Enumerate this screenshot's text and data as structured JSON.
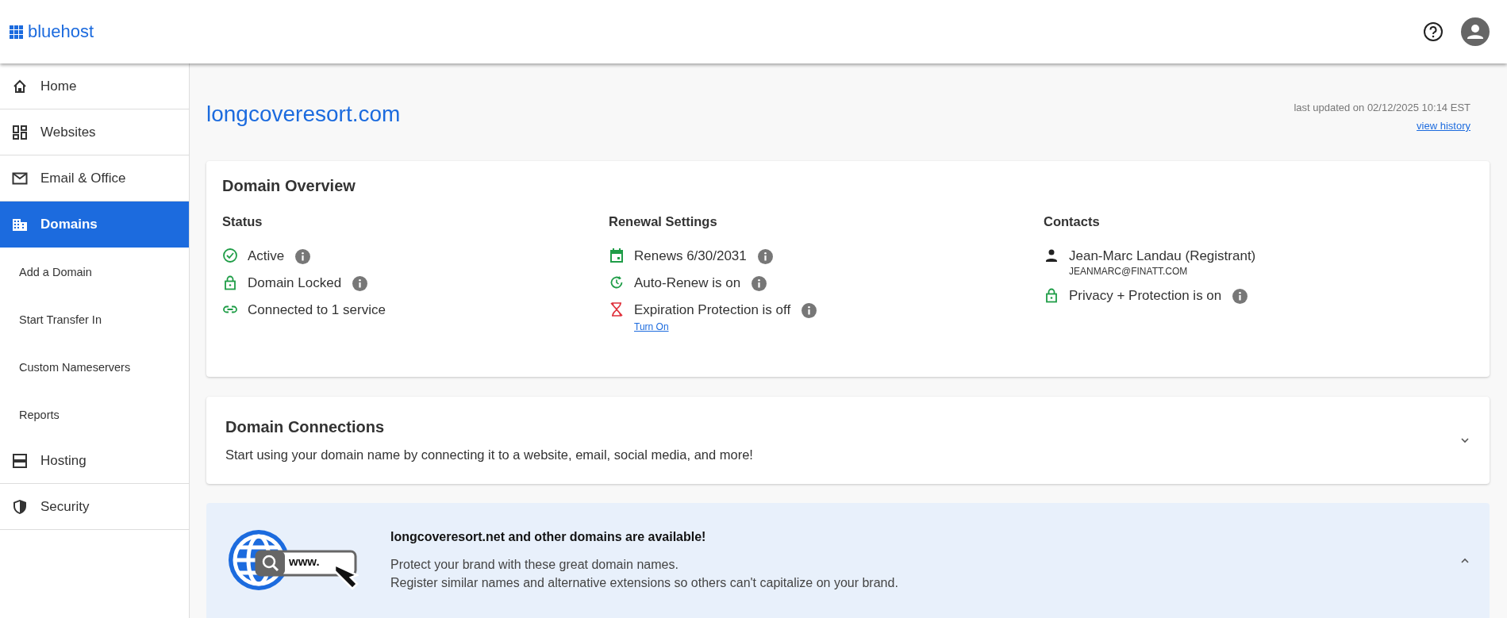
{
  "header": {
    "logo": "bluehost"
  },
  "sidebar": {
    "items": [
      {
        "label": "Home",
        "kind": "main",
        "selected": false
      },
      {
        "label": "Websites",
        "kind": "main",
        "selected": false
      },
      {
        "label": "Email & Office",
        "kind": "main",
        "selected": false
      },
      {
        "label": "Domains",
        "kind": "main",
        "selected": true
      },
      {
        "label": "Add a Domain",
        "kind": "sub",
        "selected": false
      },
      {
        "label": "Start Transfer In",
        "kind": "sub",
        "selected": false
      },
      {
        "label": "Custom Nameservers",
        "kind": "sub",
        "selected": false
      },
      {
        "label": "Reports",
        "kind": "sub",
        "selected": false
      },
      {
        "label": "Hosting",
        "kind": "main",
        "selected": false
      },
      {
        "label": "Security",
        "kind": "main",
        "selected": false
      }
    ]
  },
  "page": {
    "title": "longcoveresort.com",
    "last_updated": "last updated on 02/12/2025 10:14 EST",
    "history_link": "view history"
  },
  "domain_overview": {
    "title": "Domain Overview",
    "columns": [
      {
        "heading": "Status",
        "items": [
          {
            "label": "Active",
            "info": true
          },
          {
            "label": "Domain Locked",
            "info": true
          },
          {
            "label": "Connected to 1 service",
            "info": false
          }
        ]
      },
      {
        "heading": "Renewal Settings",
        "items": [
          {
            "label": "Renews 6/30/2031",
            "info": true
          },
          {
            "label": "Auto-Renew is on",
            "info": true
          },
          {
            "label": "Expiration Protection is off",
            "info": true,
            "link": "Turn On"
          }
        ]
      },
      {
        "heading": "Contacts",
        "items": [
          {
            "label": "Jean-Marc Landau (Registrant)",
            "info": false,
            "sub": "JEANMARC@FINATT.COM"
          },
          {
            "label": "Privacy + Protection is on",
            "info": true
          }
        ]
      }
    ]
  },
  "domain_connections": {
    "title": "Domain Connections",
    "text": "Start using your domain name by connecting it to a website, email, social media, and more!",
    "expanded": false
  },
  "banner": {
    "illustration_text": "www.",
    "title": "longcoveresort.net and other domains are available!",
    "lines": [
      "Protect your brand with these great domain names.",
      "Register similar names and alternative extensions so others can't capitalize on your brand."
    ],
    "expanded": true
  }
}
